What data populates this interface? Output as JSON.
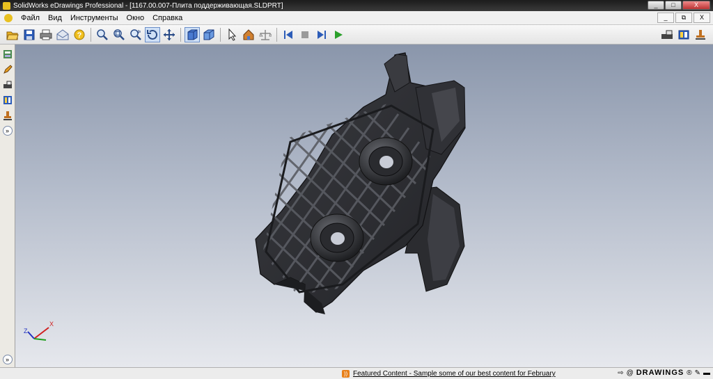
{
  "window": {
    "title": "SolidWorks eDrawings Professional - [1167.00.007-Плита поддерживающая.SLDPRT]",
    "controls": [
      "_",
      "□",
      "X"
    ]
  },
  "menu": {
    "items": [
      "Файл",
      "Вид",
      "Инструменты",
      "Окно",
      "Справка"
    ],
    "mdi_controls": [
      "_",
      "⧉",
      "X"
    ]
  },
  "toolbar": {
    "icons": [
      "open-icon",
      "save-icon",
      "print-icon",
      "send-icon",
      "help-icon",
      "zoom-to-fit-icon",
      "zoom-area-icon",
      "zoom-icon",
      "rotate-icon",
      "pan-icon",
      "shaded-icon",
      "perspective-icon",
      "select-icon",
      "home-icon",
      "measure-icon",
      "play-first-icon",
      "stop-icon",
      "step-icon",
      "play-icon",
      "markup-icon",
      "reference-icon",
      "stamp-icon"
    ]
  },
  "status": {
    "featured_text": "Featured Content - Sample some of our best content for February",
    "brand": "DRAWINGS",
    "brand_mark": "®"
  },
  "triad": {
    "z": "Z",
    "x": "X"
  },
  "colors": {
    "viewport_top": "#8a96ab",
    "viewport_bottom": "#e6e8ed",
    "part": "#2a2b2e"
  }
}
